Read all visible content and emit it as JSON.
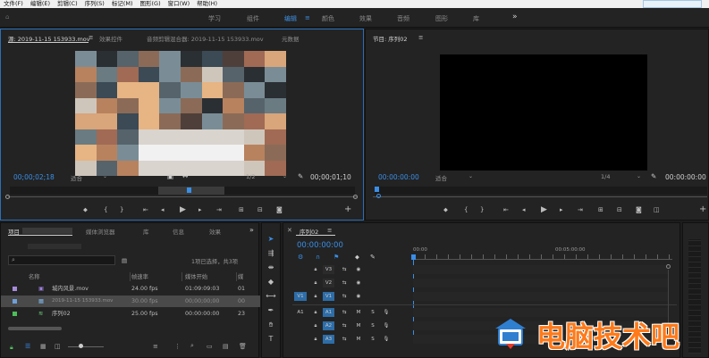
{
  "menu": {
    "items": [
      "文件(F)",
      "编辑(E)",
      "剪辑(C)",
      "序列(S)",
      "标记(M)",
      "图形(G)",
      "窗口(W)",
      "帮助(H)"
    ]
  },
  "workspaces": {
    "tabs": [
      "学习",
      "组件",
      "编辑",
      "颜色",
      "效果",
      "音频",
      "图形",
      "库"
    ],
    "active": "编辑",
    "more": "»"
  },
  "source_monitor": {
    "tabs": [
      "源: 2019-11-15 153933.mov",
      "效果控件",
      "音频剪辑混合器: 2019-11-15 153933.mov",
      "元数据"
    ],
    "timecode_in": "00;00;02;18",
    "fit": "适合",
    "resolution": "1/2",
    "timecode_dur": "00;00;01;10"
  },
  "program_monitor": {
    "title": "节目: 序列02",
    "timecode_in": "00:00:00:00",
    "fit": "适合",
    "resolution": "1/4",
    "timecode_dur": "00:00:00:00"
  },
  "project": {
    "tabs": [
      "项目",
      "媒体浏览器",
      "库",
      "信息",
      "效果",
      "»"
    ],
    "search_placeholder": "",
    "selection_info": "1项已选择，共3项",
    "columns": [
      "名称",
      "帧速率",
      "媒体开始",
      "媒"
    ],
    "rows": [
      {
        "name": "城内风景.mov",
        "fps": "24.00 fps",
        "start": "01:09:09:03",
        "extra": "01",
        "color": "#a78bdb"
      },
      {
        "name": "2019-11-15 153933.mov",
        "fps": "30.00 fps",
        "start": "00;00;00;00",
        "extra": "00",
        "color": "#6f9fd8"
      },
      {
        "name": "序列02",
        "fps": "25.00 fps",
        "start": "00:00:00:00",
        "extra": "23",
        "color": "#4cbf5a"
      }
    ]
  },
  "timeline": {
    "title": "序列02",
    "timecode": "00:00:00:00",
    "ruler": [
      "00:00",
      "00:05:00:00"
    ],
    "tracks": [
      "V3",
      "V2",
      "V1",
      "A1",
      "A2",
      "A3"
    ],
    "source_v": "V1",
    "source_a": "A1",
    "mute": "M",
    "solo": "S"
  },
  "watermark": {
    "text": "电脑技术吧"
  }
}
